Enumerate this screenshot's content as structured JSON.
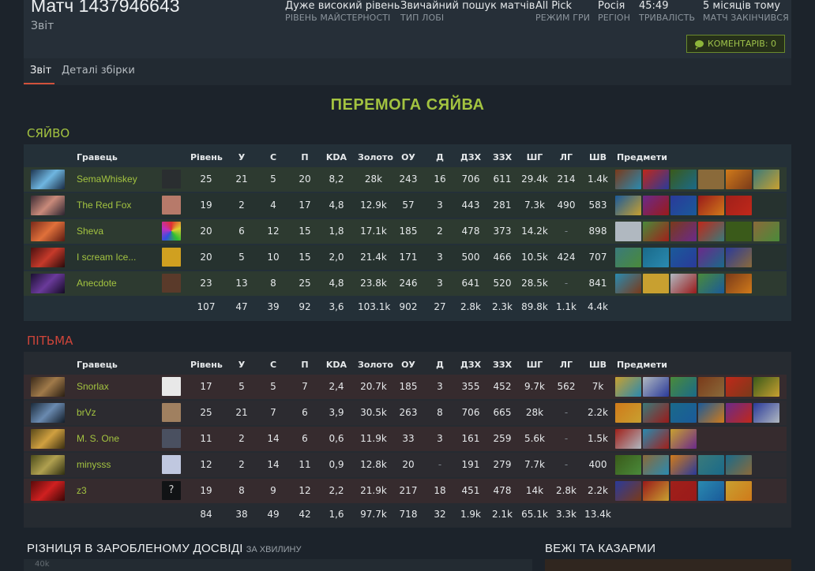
{
  "match": {
    "title": "Матч 1437946643",
    "subtitle": "Звіт",
    "meta": [
      {
        "value": "Дуже високий рівень",
        "key": "Рівень майстерності"
      },
      {
        "value": "Звичайний пошук матчів",
        "key": "Тип лобі"
      },
      {
        "value": "All Pick",
        "key": "Режим гри"
      },
      {
        "value": "Росія",
        "key": "Регіон"
      },
      {
        "value": "45:49",
        "key": "Тривалість"
      },
      {
        "value": "5 місяців тому",
        "key": "Матч закінчився"
      }
    ],
    "comments_label": "КОМЕНТАРІВ: 0"
  },
  "tabs": [
    {
      "label": "Звіт",
      "active": true
    },
    {
      "label": "Деталі збірки",
      "active": false
    }
  ],
  "result": "ПЕРЕМОГА СЯЙВА",
  "columns": [
    "Гравець",
    "Рівень",
    "У",
    "С",
    "П",
    "KDA",
    "Золото",
    "ОУ",
    "Д",
    "ДЗХ",
    "ЗЗХ",
    "ШГ",
    "ЛГ",
    "ШВ",
    "Предмети"
  ],
  "radiant": {
    "label": "СЯЙВО",
    "players": [
      {
        "name": "SemaWhiskey",
        "level": "25",
        "k": "21",
        "d": "5",
        "a": "20",
        "kda": "8,2",
        "gold": "28k",
        "lh": "243",
        "dn": "16",
        "xpm": "706",
        "gpm": "611",
        "hd": "29.4k",
        "hh": "214",
        "td": "1.4k"
      },
      {
        "name": "The Red Fox",
        "level": "19",
        "k": "2",
        "d": "4",
        "a": "17",
        "kda": "4,8",
        "gold": "12.9k",
        "lh": "57",
        "dn": "3",
        "xpm": "443",
        "gpm": "281",
        "hd": "7.3k",
        "hh": "490",
        "td": "583"
      },
      {
        "name": "Sheva",
        "level": "20",
        "k": "6",
        "d": "12",
        "a": "15",
        "kda": "1,8",
        "gold": "17.1k",
        "lh": "185",
        "dn": "2",
        "xpm": "478",
        "gpm": "373",
        "hd": "14.2k",
        "hh": "-",
        "td": "898"
      },
      {
        "name": "I scream Ice...",
        "level": "20",
        "k": "5",
        "d": "10",
        "a": "15",
        "kda": "2,0",
        "gold": "21.4k",
        "lh": "171",
        "dn": "3",
        "xpm": "500",
        "gpm": "466",
        "hd": "10.5k",
        "hh": "424",
        "td": "707"
      },
      {
        "name": "Anecdote",
        "level": "23",
        "k": "13",
        "d": "8",
        "a": "25",
        "kda": "4,8",
        "gold": "23.8k",
        "lh": "246",
        "dn": "3",
        "xpm": "641",
        "gpm": "520",
        "hd": "28.5k",
        "hh": "-",
        "td": "841"
      }
    ],
    "totals": {
      "level": "107",
      "k": "47",
      "d": "39",
      "a": "92",
      "kda": "3,6",
      "gold": "103.1k",
      "lh": "902",
      "dn": "27",
      "xpm": "2.8k",
      "gpm": "2.3k",
      "hd": "89.8k",
      "hh": "1.1k",
      "td": "4.4k"
    }
  },
  "dire": {
    "label": "ПІТЬМА",
    "players": [
      {
        "name": "Snorlax",
        "level": "17",
        "k": "5",
        "d": "5",
        "a": "7",
        "kda": "2,4",
        "gold": "20.7k",
        "lh": "185",
        "dn": "3",
        "xpm": "355",
        "gpm": "452",
        "hd": "9.7k",
        "hh": "562",
        "td": "7k"
      },
      {
        "name": "brVz",
        "level": "25",
        "k": "21",
        "d": "7",
        "a": "6",
        "kda": "3,9",
        "gold": "30.5k",
        "lh": "263",
        "dn": "8",
        "xpm": "706",
        "gpm": "665",
        "hd": "28k",
        "hh": "-",
        "td": "2.2k"
      },
      {
        "name": "M. S. One",
        "level": "11",
        "k": "2",
        "d": "14",
        "a": "6",
        "kda": "0,6",
        "gold": "11.9k",
        "lh": "33",
        "dn": "3",
        "xpm": "161",
        "gpm": "259",
        "hd": "5.6k",
        "hh": "-",
        "td": "1.5k"
      },
      {
        "name": "minysss",
        "level": "12",
        "k": "2",
        "d": "14",
        "a": "11",
        "kda": "0,9",
        "gold": "12.8k",
        "lh": "20",
        "dn": "-",
        "xpm": "191",
        "gpm": "279",
        "hd": "7.7k",
        "hh": "-",
        "td": "400"
      },
      {
        "name": "z3",
        "level": "19",
        "k": "8",
        "d": "9",
        "a": "12",
        "kda": "2,2",
        "gold": "21.9k",
        "lh": "217",
        "dn": "18",
        "xpm": "451",
        "gpm": "478",
        "hd": "14k",
        "hh": "2.8k",
        "td": "2.2k"
      }
    ],
    "totals": {
      "level": "84",
      "k": "38",
      "d": "49",
      "a": "42",
      "kda": "1,6",
      "gold": "97.7k",
      "lh": "718",
      "dn": "32",
      "xpm": "1.9k",
      "gpm": "2.1k",
      "hd": "65.1k",
      "hh": "3.3k",
      "td": "13.4k"
    }
  },
  "sections": {
    "xp_title": "РІЗНИЦЯ В ЗАРОБЛЕНОМУ ДОСВІДІ",
    "xp_sub": "ЗА ХВИЛИНУ",
    "xp_axis_tick": "40k",
    "towers_title": "ВЕЖІ ТА КАЗАРМИ"
  },
  "colors": {
    "radiant": "#a3c340",
    "dire": "#d0453a",
    "accent": "#d1513b"
  }
}
